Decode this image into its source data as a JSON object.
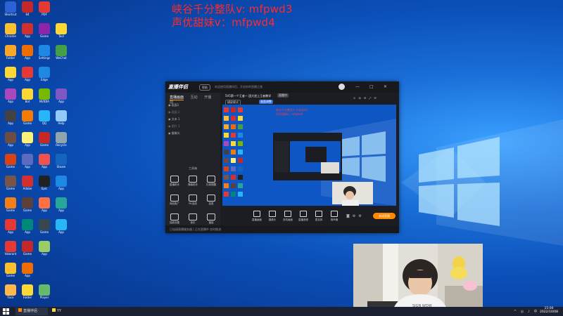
{
  "overlay": {
    "line1": "峡谷千分整队v: mfpwd3",
    "line2": "声优甜妹v：mfpwd4"
  },
  "desktop_icons": [
    {
      "label": "Shortcut",
      "color": "#2b62d6"
    },
    {
      "label": "64",
      "color": "#c62828"
    },
    {
      "label": "PDF",
      "color": "#e53935"
    },
    {
      "label": "Chrome",
      "color": "#fbc02d"
    },
    {
      "label": "App",
      "color": "#d32f2f"
    },
    {
      "label": "Game",
      "color": "#8e24aa"
    },
    {
      "label": "Tool",
      "color": "#fdd835"
    },
    {
      "label": "Folder",
      "color": "#f9a825"
    },
    {
      "label": "App",
      "color": "#ef6c00"
    },
    {
      "label": "Settings",
      "color": "#1e88e5"
    },
    {
      "label": "WeChat",
      "color": "#43a047"
    },
    {
      "label": "App",
      "color": "#fdd835"
    },
    {
      "label": "App",
      "color": "#e53935"
    },
    {
      "label": "Edge",
      "color": "#1e88e5"
    },
    {
      "label": "App",
      "color": "#ab47bc"
    },
    {
      "label": "Bot",
      "color": "#fdd835"
    },
    {
      "label": "NVIDIA",
      "color": "#76b900"
    },
    {
      "label": "App",
      "color": "#7e57c2"
    },
    {
      "label": "App",
      "color": "#424242"
    },
    {
      "label": "Game",
      "color": "#f57c00"
    },
    {
      "label": "QQ",
      "color": "#29b6f6"
    },
    {
      "label": "Help",
      "color": "#90caf9"
    },
    {
      "label": "App",
      "color": "#6d4c41"
    },
    {
      "label": "App",
      "color": "#fff176"
    },
    {
      "label": "Game",
      "color": "#c62828"
    },
    {
      "label": "Recycle",
      "color": "#90a4ae"
    },
    {
      "label": "Game",
      "color": "#d84315"
    },
    {
      "label": "App",
      "color": "#5c6bc0"
    },
    {
      "label": "App",
      "color": "#ef5350"
    },
    {
      "label": "Steam",
      "color": "#1565c0"
    },
    {
      "label": "Game",
      "color": "#795548"
    },
    {
      "label": "Adobe",
      "color": "#d32f2f"
    },
    {
      "label": "Epic",
      "color": "#212121"
    },
    {
      "label": "App",
      "color": "#1e88e5"
    },
    {
      "label": "Game",
      "color": "#f57f17"
    },
    {
      "label": "Game",
      "color": "#5d4037"
    },
    {
      "label": "App",
      "color": "#ff7043"
    },
    {
      "label": "App",
      "color": "#26a69a"
    },
    {
      "label": "App",
      "color": "#e53935"
    },
    {
      "label": "App",
      "color": "#00897b"
    },
    {
      "label": "Game",
      "color": "#37474f"
    },
    {
      "label": "App",
      "color": "#29b6f6"
    },
    {
      "label": "Valorant",
      "color": "#e53935"
    },
    {
      "label": "Game",
      "color": "#c62828"
    },
    {
      "label": "App",
      "color": "#9ccc65"
    },
    {
      "label": "Game",
      "color": "#fbc02d"
    },
    {
      "label": "App",
      "color": "#ef6c00"
    },
    {
      "label": "Face",
      "color": "#ffb74d"
    },
    {
      "label": "Folder",
      "color": "#fdd835"
    },
    {
      "label": "Player",
      "color": "#66bb6a"
    }
  ],
  "app": {
    "logo": "直播伴侣",
    "badge": "帮助",
    "announcement": "欢迎使用直播伴侣，开启你的直播之旅",
    "window_controls": [
      "—",
      "□",
      "✕"
    ],
    "tabs": [
      "直播画面",
      "互动",
      "开播前"
    ],
    "sources": [
      "画面1",
      "画面 2",
      "文本 1",
      "图片 1",
      "摄像头"
    ],
    "tools_title": "工具箱",
    "tools": [
      "直播助手",
      "弹幕助手",
      "礼物提醒",
      "商品推广",
      "PK连线",
      "连麦",
      "抽奖设置",
      "音乐",
      "福袋",
      "更多"
    ],
    "preview_title": "5V5第一个王者一 团大逆上王者教学",
    "preview_tag": "直播中",
    "preview_mode": "横屏模式",
    "preview_label": "画面调整",
    "bottom_tools": [
      "直播画面",
      "摄像头",
      "多机画面",
      "直播音频",
      "麦克风",
      "扬声器"
    ],
    "go_live": "关闭直播",
    "status": "已连接直播服务器 | 正在直播中 实时推流"
  },
  "taskbar": {
    "items": [
      "直播伴侣",
      "YY"
    ],
    "time": "15:00",
    "date": "2022/10/08"
  }
}
